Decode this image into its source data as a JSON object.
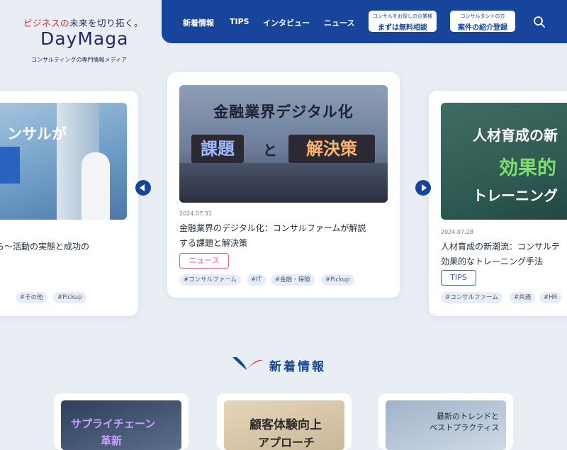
{
  "brand": {
    "tagline_red": "ビジネスの",
    "tagline_dark": "未来を切り拓く。",
    "name": "DayMaga",
    "subtitle": "コンサルティングの専門情報メディア"
  },
  "nav": {
    "links": [
      "新着情報",
      "TIPS",
      "インタビュー",
      "ニュース"
    ],
    "cta_company": {
      "small": "コンサルをお探しの企業様",
      "big": "まずは無料相談"
    },
    "cta_consultant": {
      "small": "コンサルタントの方",
      "big": "案件の紹介登録"
    }
  },
  "carousel": {
    "left_card": {
      "image_text": "ンサルが",
      "title_line1": "場から〜活動の実態と成功の",
      "tags": [
        "通",
        "#その他",
        "#Pickup"
      ]
    },
    "center_card": {
      "image_line1": "金融業界デジタル化",
      "image_word1": "課題",
      "image_and": "と",
      "image_word2": "解決策",
      "date": "2024.07.31",
      "title_line1": "金融業界のデジタル化：コンサルファームが解説",
      "title_line2": "する課題と解決策",
      "category": "ニュース",
      "tags": [
        "#コンサルファーム",
        "#IT",
        "#金融・保険",
        "#Pickup"
      ]
    },
    "right_card": {
      "image_line1": "人材育成の新",
      "image_line2": "効果的",
      "image_line3": "トレーニング",
      "date": "2024.07.28",
      "title_line1": "人材育成の新潮流：コンサルテ",
      "title_line2": "効果的なトレーニング手法",
      "category": "TIPS",
      "tags": [
        "#コンサルファーム",
        "#共通",
        "#HR"
      ]
    }
  },
  "section": {
    "title": "新着情報"
  },
  "latest": [
    {
      "image_text": "サプライチェーン",
      "image_text2": "革新"
    },
    {
      "image_text": "顧客体験向上",
      "image_text2": "アプローチ"
    },
    {
      "image_text": "最新のトレンドと",
      "image_text2": "ベストプラクティス"
    }
  ],
  "colors": {
    "brand_blue": "#16459b",
    "accent_red": "#d52a2a",
    "badge_pink": "#d65fa0",
    "background": "#e9eef4"
  }
}
